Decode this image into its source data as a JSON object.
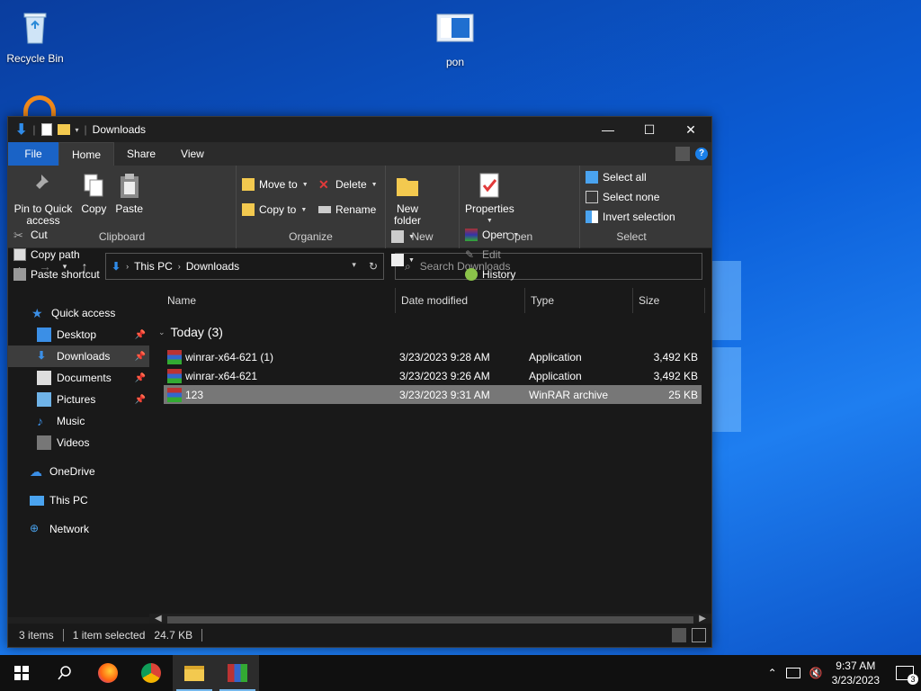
{
  "desktop": {
    "icons": [
      {
        "label": "Recycle Bin"
      },
      {
        "label": "pon"
      }
    ]
  },
  "window": {
    "title": "Downloads",
    "controls": {
      "minimize": "—",
      "maximize": "☐",
      "close": "✕"
    },
    "tabs": [
      "File",
      "Home",
      "Share",
      "View"
    ],
    "ribbon": {
      "clipboard": {
        "pin": "Pin to Quick access",
        "copy": "Copy",
        "paste": "Paste",
        "cut": "Cut",
        "copy_path": "Copy path",
        "paste_shortcut": "Paste shortcut",
        "label": "Clipboard"
      },
      "organize": {
        "move_to": "Move to",
        "copy_to": "Copy to",
        "delete": "Delete",
        "rename": "Rename",
        "label": "Organize"
      },
      "new": {
        "new_folder": "New folder",
        "label": "New"
      },
      "open": {
        "properties": "Properties",
        "open": "Open",
        "edit": "Edit",
        "history": "History",
        "label": "Open"
      },
      "select": {
        "select_all": "Select all",
        "select_none": "Select none",
        "invert": "Invert selection",
        "label": "Select"
      }
    },
    "address": {
      "crumbs": [
        "This PC",
        "Downloads"
      ],
      "search_placeholder": "Search Downloads"
    },
    "nav": {
      "quick_access": "Quick access",
      "items": [
        {
          "label": "Desktop"
        },
        {
          "label": "Downloads"
        },
        {
          "label": "Documents"
        },
        {
          "label": "Pictures"
        },
        {
          "label": "Music"
        },
        {
          "label": "Videos"
        }
      ],
      "onedrive": "OneDrive",
      "this_pc": "This PC",
      "network": "Network"
    },
    "columns": [
      "Name",
      "Date modified",
      "Type",
      "Size"
    ],
    "group": "Today (3)",
    "files": [
      {
        "name": "winrar-x64-621 (1)",
        "date": "3/23/2023 9:28 AM",
        "type": "Application",
        "size": "3,492 KB"
      },
      {
        "name": "winrar-x64-621",
        "date": "3/23/2023 9:26 AM",
        "type": "Application",
        "size": "3,492 KB"
      },
      {
        "name": "123",
        "date": "3/23/2023 9:31 AM",
        "type": "WinRAR archive",
        "size": "25 KB"
      }
    ],
    "status": {
      "items": "3 items",
      "selected": "1 item selected",
      "size": "24.7 KB"
    }
  },
  "taskbar": {
    "time": "9:37 AM",
    "date": "3/23/2023",
    "notifications": "3"
  },
  "colors": {
    "accent": "#1a63c6",
    "window_bg": "#191919",
    "ribbon_bg": "#383838",
    "selection": "#777777"
  }
}
